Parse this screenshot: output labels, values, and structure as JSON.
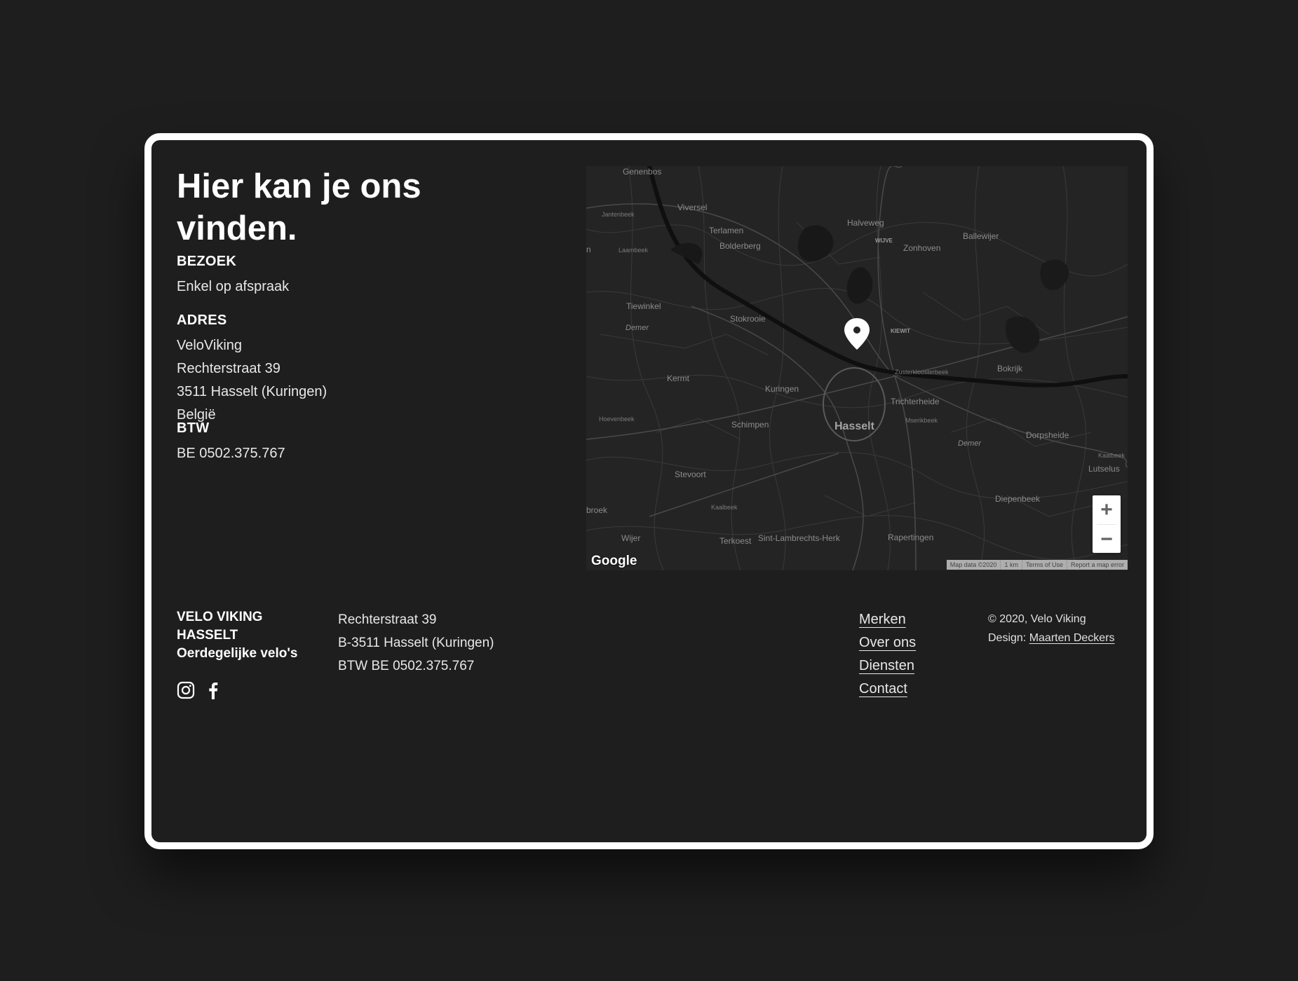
{
  "contact": {
    "title": "Hier kan je ons vinden.",
    "visit": {
      "heading": "BEZOEK",
      "text": "Enkel op afspraak"
    },
    "address": {
      "heading": "ADRES",
      "lines": [
        "VeloViking",
        "Rechterstraat 39",
        "3511 Hasselt (Kuringen)",
        "België"
      ]
    },
    "vat": {
      "heading": "BTW",
      "text": "BE 0502.375.767"
    }
  },
  "map": {
    "labels": {
      "genenbos": "Genenbos",
      "viversel": "Viversel",
      "terlamen": "Terlamen",
      "bolderberg": "Bolderberg",
      "halveweg": "Halveweg",
      "wijve": "WIJVE",
      "zonhoven": "Zonhoven",
      "ballewijer": "Ballewijer",
      "laambeek": "Laambeek",
      "jantenbeek": "Jantenbeek",
      "tiewinkel": "Tiewinkel",
      "stokrooie": "Stokrooie",
      "demer1": "Demer",
      "kiewit": "KIEWIT",
      "kermt": "Kermt",
      "kuringen": "Kuringen",
      "zusterkloosterbeek": "Zusterkloosterbeek",
      "bokrijk": "Bokrijk",
      "trichterheide": "Trichterheide",
      "hoevenbeek": "Hoevenbeek",
      "schimpen": "Schimpen",
      "hasselt": "Hasselt",
      "mserikbeek": "Mserikbeek",
      "dorpsheide": "Dorpsheide",
      "demer2": "Demer",
      "kaatbeek": "Kaatbeek",
      "lutselus": "Lutselus",
      "stevoort": "Stevoort",
      "diepenbeek": "Diepenbeek",
      "broek": "broek",
      "kaalbeek": "Kaalbeek",
      "wijer": "Wijer",
      "terkoest": "Terkoest",
      "sintlambrechts": "Sint-Lambrechts-Herk",
      "rapertingen": "Rapertingen",
      "n": "n"
    },
    "zoom_in": "+",
    "zoom_out": "−",
    "google": "Google",
    "attribution": {
      "data": "Map data ©2020",
      "scale": "1 km",
      "terms": "Terms of Use",
      "report": "Report a map error"
    }
  },
  "footer": {
    "brand_line1": "VELO VIKING",
    "brand_line2": "HASSELT",
    "tagline": "Oerdegelijke velo's",
    "address_lines": [
      "Rechterstraat 39",
      "B-3511 Hasselt (Kuringen)",
      "BTW BE 0502.375.767"
    ],
    "nav": [
      "Merken",
      "Over ons",
      "Diensten",
      "Contact"
    ],
    "copyright": "© 2020, Velo Viking",
    "design_prefix": "Design: ",
    "designer": "Maarten Deckers"
  }
}
